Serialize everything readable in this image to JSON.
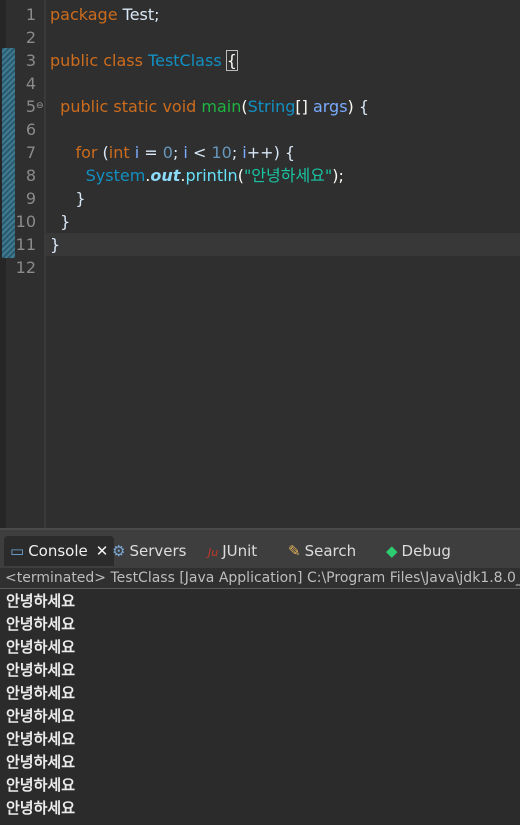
{
  "editor": {
    "lines": [
      {
        "n": "1",
        "tokens": [
          [
            "kw",
            "package"
          ],
          [
            "plain",
            " Test;"
          ]
        ]
      },
      {
        "n": "2",
        "tokens": []
      },
      {
        "n": "3",
        "tokens": [
          [
            "kw",
            "public"
          ],
          [
            "plain",
            " "
          ],
          [
            "kw",
            "class"
          ],
          [
            "plain",
            " "
          ],
          [
            "cls",
            "TestClass"
          ],
          [
            "plain",
            " "
          ],
          [
            "braceBox",
            "{"
          ]
        ]
      },
      {
        "n": "4",
        "tokens": []
      },
      {
        "n": "5",
        "tokens": [
          [
            "plain",
            "  "
          ],
          [
            "kw",
            "public"
          ],
          [
            "plain",
            " "
          ],
          [
            "kw",
            "static"
          ],
          [
            "plain",
            " "
          ],
          [
            "kw",
            "void"
          ],
          [
            "plain",
            " "
          ],
          [
            "fn",
            "main"
          ],
          [
            "punct",
            "("
          ],
          [
            "cls",
            "String"
          ],
          [
            "punct",
            "[]"
          ],
          [
            "plain",
            " "
          ],
          [
            "var",
            "args"
          ],
          [
            "punct",
            ")"
          ],
          [
            "plain",
            " {"
          ]
        ]
      },
      {
        "n": "6",
        "tokens": []
      },
      {
        "n": "7",
        "tokens": [
          [
            "plain",
            "     "
          ],
          [
            "kw",
            "for"
          ],
          [
            "plain",
            " ("
          ],
          [
            "kw",
            "int"
          ],
          [
            "plain",
            " "
          ],
          [
            "var",
            "i"
          ],
          [
            "plain",
            " = "
          ],
          [
            "num",
            "0"
          ],
          [
            "plain",
            "; "
          ],
          [
            "var",
            "i"
          ],
          [
            "plain",
            " < "
          ],
          [
            "num",
            "10"
          ],
          [
            "plain",
            "; "
          ],
          [
            "var",
            "i"
          ],
          [
            "plain",
            "++) {"
          ]
        ]
      },
      {
        "n": "8",
        "tokens": [
          [
            "plain",
            "       "
          ],
          [
            "cls",
            "System"
          ],
          [
            "punct",
            "."
          ],
          [
            "sfield",
            "out"
          ],
          [
            "punct",
            "."
          ],
          [
            "field",
            "println"
          ],
          [
            "punct",
            "("
          ],
          [
            "str",
            "\"안녕하세요\""
          ],
          [
            "punct",
            ");"
          ]
        ]
      },
      {
        "n": "9",
        "tokens": [
          [
            "plain",
            "     }"
          ]
        ]
      },
      {
        "n": "10",
        "tokens": [
          [
            "plain",
            "  }"
          ]
        ]
      },
      {
        "n": "11",
        "tokens": [
          [
            "plain",
            "}"
          ]
        ]
      },
      {
        "n": "12",
        "tokens": []
      }
    ]
  },
  "console": {
    "tabs": [
      {
        "label": "Console",
        "icon": "console-icon",
        "glyph": "▭",
        "color": "#6fa8dc",
        "closable": true,
        "close_glyph": "✕"
      },
      {
        "label": "Servers",
        "icon": "servers-icon",
        "glyph": "⚙",
        "color": "#7aa7d6"
      },
      {
        "label": "JUnit",
        "icon": "junit-icon",
        "glyph": "Ju",
        "color": "#c0392b"
      },
      {
        "label": "Search",
        "icon": "search-icon",
        "glyph": "✎",
        "color": "#e6b35a"
      },
      {
        "label": "Debug",
        "icon": "debug-icon",
        "glyph": "◆",
        "color": "#2ecc71"
      }
    ],
    "launch_info": "<terminated> TestClass [Java Application] C:\\Program Files\\Java\\jdk1.8.0_",
    "output": [
      "안녕하세요",
      "안녕하세요",
      "안녕하세요",
      "안녕하세요",
      "안녕하세요",
      "안녕하세요",
      "안녕하세요",
      "안녕하세요",
      "안녕하세요",
      "안녕하세요"
    ]
  }
}
